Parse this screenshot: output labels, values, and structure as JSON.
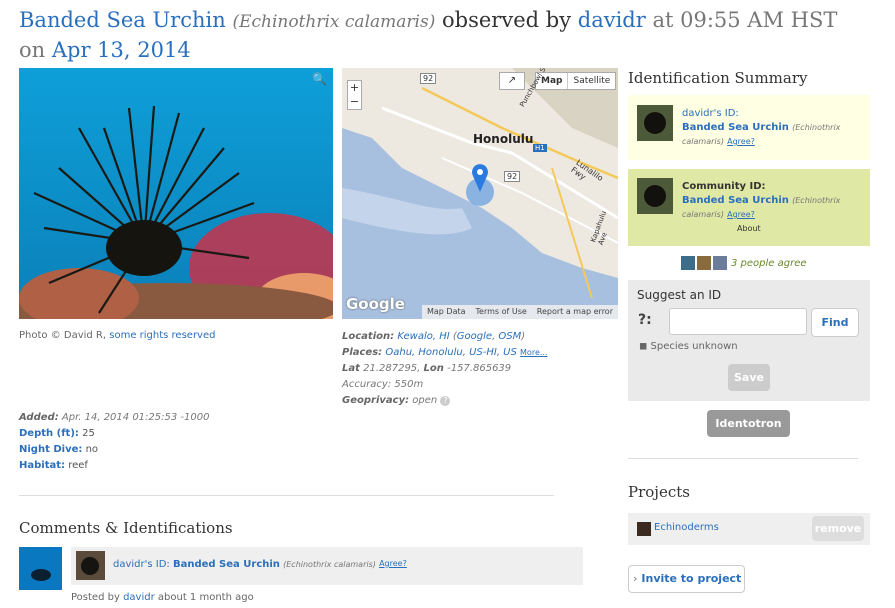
{
  "title": {
    "taxon": "Banded Sea Urchin",
    "sci": "Echinothrix calamaris",
    "by": "observed by",
    "user": "davidr",
    "at": "at 09:55 AM HST on",
    "date": "Apr 13, 2014"
  },
  "photo": {
    "credit_prefix": "Photo © David R,",
    "credit_link": "some rights reserved"
  },
  "map": {
    "zoom_in": "+",
    "zoom_out": "−",
    "btn_map": "Map",
    "btn_sat": "Satellite",
    "city": "Honolulu",
    "road1": "92",
    "road2": "92",
    "road3": "H1",
    "road4": "Lunalilo Fwy",
    "road5": "Kapahulu Ave",
    "road6": "Punchbowl St",
    "logo": "Google",
    "f1": "Map Data",
    "f2": "Terms of Use",
    "f3": "Report a map error"
  },
  "location": {
    "loc_label": "Location:",
    "loc_val": "Kewalo, HI",
    "loc_paren1": "Google",
    "loc_paren2": "OSM",
    "places_label": "Places:",
    "places_val": "Oahu, Honolulu, US-HI, US",
    "more": "More...",
    "lat_label": "Lat",
    "lat": "21.287295,",
    "lon_label": "Lon",
    "lon": "-157.865639",
    "acc_label": "Accuracy:",
    "acc": "550m",
    "geo_label": "Geoprivacy:",
    "geo": "open"
  },
  "details": {
    "added_label": "Added:",
    "added": "Apr. 14, 2014 01:25:53 -1000",
    "depth_label": "Depth (ft):",
    "depth": "25",
    "night_label": "Night Dive:",
    "night": "no",
    "hab_label": "Habitat:",
    "hab": "reef"
  },
  "id_summary": {
    "heading": "Identification Summary",
    "user_id": "davidr's ID:",
    "taxon": "Banded Sea Urchin",
    "sci": "Echinothrix calamaris",
    "agree": "Agree?",
    "community_id": "Community ID:",
    "about": "About",
    "agree_count": "3 people agree"
  },
  "suggest": {
    "heading": "Suggest an ID",
    "find": "Find",
    "unknown": "Species unknown",
    "save": "Save",
    "identotron": "Identotron"
  },
  "projects": {
    "heading": "Projects",
    "item": "Echinoderms",
    "remove": "remove",
    "invite": "Invite to project"
  },
  "comments": {
    "heading": "Comments & Identifications",
    "user_id": "davidr's ID:",
    "taxon": "Banded Sea Urchin",
    "sci": "Echinothrix calamaris",
    "agree": "Agree?",
    "posted_by": "Posted by",
    "user": "davidr",
    "when": "about 1 month ago"
  }
}
